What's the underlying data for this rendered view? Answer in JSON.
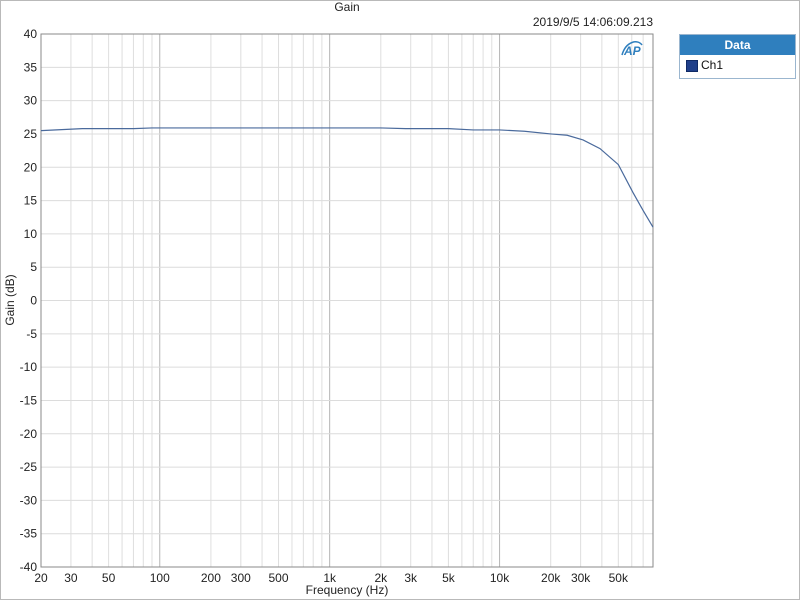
{
  "chart_data": {
    "type": "line",
    "title": "Gain",
    "timestamp": "2019/9/5 14:06:09.213",
    "xlabel": "Frequency (Hz)",
    "ylabel": "Gain (dB)",
    "x_scale": "log",
    "xlim": [
      20,
      80000
    ],
    "ylim": [
      -40,
      40
    ],
    "grid": true,
    "legend_placement": "right",
    "y_ticks": [
      40,
      35,
      30,
      25,
      20,
      15,
      10,
      5,
      0,
      -5,
      -10,
      -15,
      -20,
      -25,
      -30,
      -35,
      -40
    ],
    "x_ticks": [
      {
        "value": 20,
        "label": "20"
      },
      {
        "value": 30,
        "label": "30"
      },
      {
        "value": 50,
        "label": "50"
      },
      {
        "value": 100,
        "label": "100"
      },
      {
        "value": 200,
        "label": "200"
      },
      {
        "value": 300,
        "label": "300"
      },
      {
        "value": 500,
        "label": "500"
      },
      {
        "value": 1000,
        "label": "1k"
      },
      {
        "value": 2000,
        "label": "2k"
      },
      {
        "value": 3000,
        "label": "3k"
      },
      {
        "value": 5000,
        "label": "5k"
      },
      {
        "value": 10000,
        "label": "10k"
      },
      {
        "value": 20000,
        "label": "20k"
      },
      {
        "value": 30000,
        "label": "30k"
      },
      {
        "value": 50000,
        "label": "50k"
      }
    ],
    "legend_title": "Data",
    "series": [
      {
        "name": "Ch1",
        "color": "#4a6a9c",
        "x": [
          20,
          35,
          70,
          90,
          200,
          500,
          1000,
          2000,
          2800,
          5000,
          7000,
          10000,
          14000,
          20000,
          25000,
          31000,
          39000,
          50000,
          61000,
          70000,
          80000
        ],
        "y": [
          25.5,
          25.8,
          25.8,
          25.9,
          25.9,
          25.9,
          25.9,
          25.9,
          25.8,
          25.8,
          25.6,
          25.6,
          25.4,
          25.0,
          24.8,
          24.1,
          22.8,
          20.4,
          16.2,
          13.5,
          11.0
        ]
      }
    ]
  }
}
